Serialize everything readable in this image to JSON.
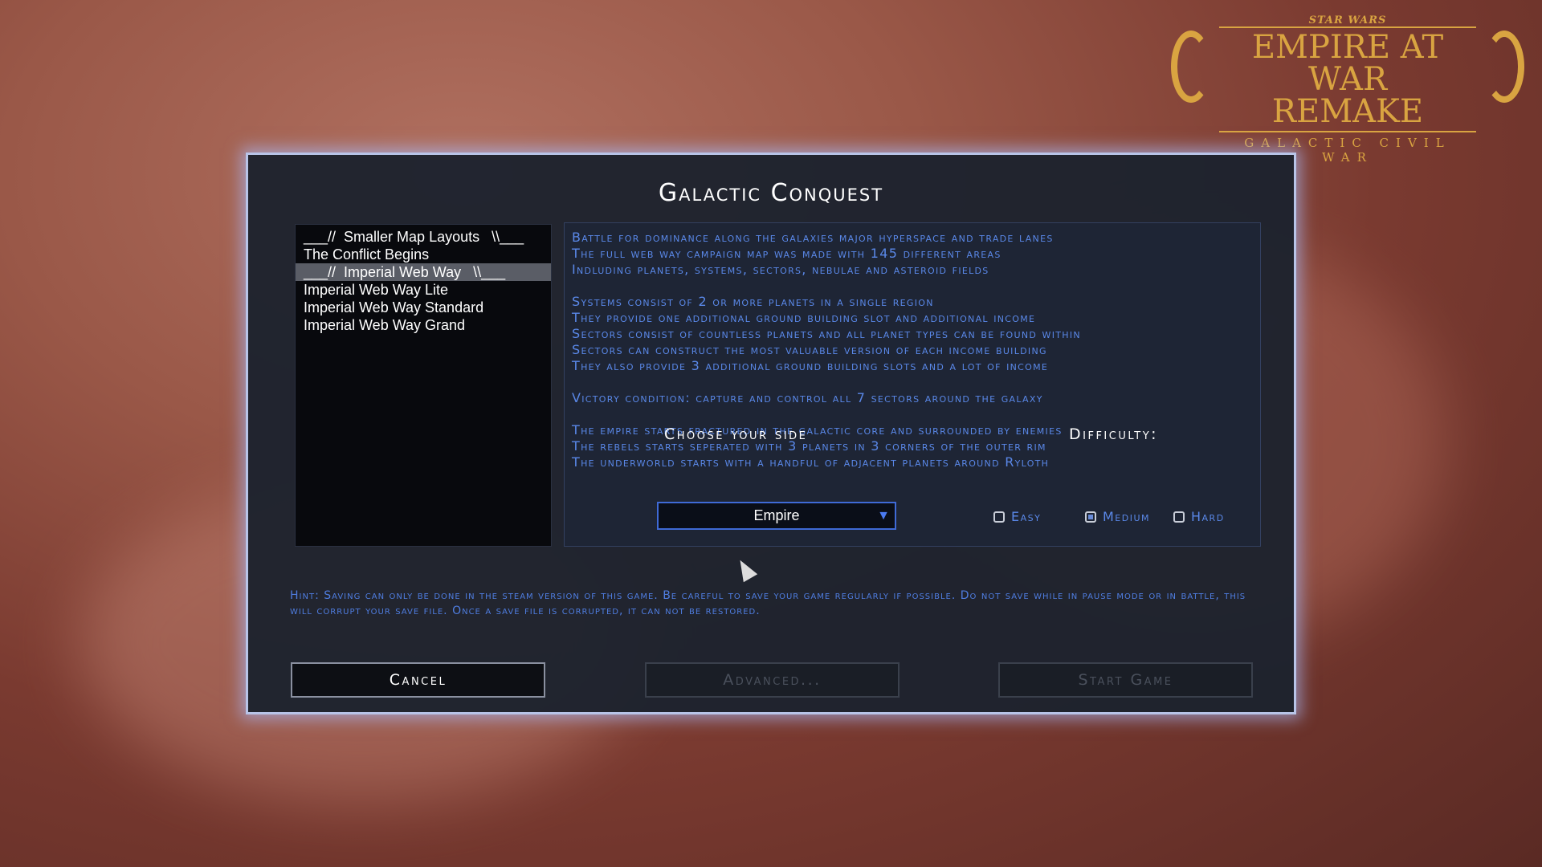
{
  "logo": {
    "top": "STAR WARS",
    "title_line1": "EMPIRE AT WAR",
    "title_line2": "REMAKE",
    "subtitle": "GALACTIC CIVIL WAR"
  },
  "dialog": {
    "title": "Galactic Conquest",
    "map_list": [
      {
        "label": "___//  Smaller Map Layouts   \\\\___",
        "selected": false
      },
      {
        "label": "The Conflict Begins",
        "selected": false
      },
      {
        "label": "___//  Imperial Web Way   \\\\___",
        "selected": true
      },
      {
        "label": "Imperial Web Way Lite",
        "selected": false
      },
      {
        "label": "Imperial Web Way Standard",
        "selected": false
      },
      {
        "label": "Imperial Web Way Grand",
        "selected": false
      }
    ],
    "description_lines": [
      "Battle for dominance along the galaxies major hyperspace and trade lanes",
      "The full web way campaign map was made with 145 different areas",
      "Indluding planets, systems, sectors, nebulae and asteroid fields",
      "",
      "Systems consist of 2 or more planets in a single region",
      "They provide one additional ground building slot and additional income",
      "Sectors consist of countless planets and all planet types can be found within",
      "Sectors can construct the most valuable version of each income building",
      "They also provide 3 additional ground building slots and a lot of income",
      "",
      "Victory condition: capture and control all 7 sectors around the galaxy",
      "",
      "The empire starts fractured in the galactic core and surrounded by enemies",
      "The rebels starts seperated with 3 planets in 3 corners of the outer rim",
      "The underworld starts with a handful of adjacent planets around Ryloth"
    ],
    "choose_side_label": "Choose your side",
    "side_value": "Empire",
    "difficulty_label": "Difficulty:",
    "difficulty": {
      "easy": "Easy",
      "medium": "Medium",
      "hard": "Hard",
      "selected": "medium"
    },
    "hint": "Hint: Saving can only be done in the steam version of this game. Be careful to save your game regularly if possible. Do not save while in pause mode or in battle, this will corrupt your save file. Once a save file is corrupted, it can not be restored.",
    "buttons": {
      "cancel": "Cancel",
      "advanced": "Advanced...",
      "start": "Start Game"
    }
  },
  "colors": {
    "accent_text": "#5a88e8",
    "logo_gold": "#d9a441",
    "glow": "#b8c4e8"
  }
}
